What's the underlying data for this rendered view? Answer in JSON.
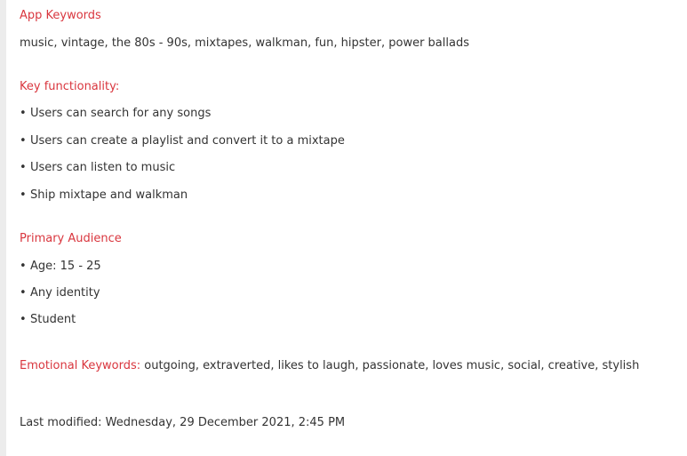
{
  "sections": {
    "app_keywords": {
      "heading": "App Keywords",
      "text": "music, vintage, the 80s - 90s, mixtapes, walkman, fun, hipster, power ballads"
    },
    "key_functionality": {
      "heading": "Key functionality:",
      "items": [
        "Users can search for any songs",
        "Users can create a playlist and convert it to a mixtape",
        "Users can listen to music",
        "Ship mixtape and walkman"
      ]
    },
    "primary_audience": {
      "heading": "Primary Audience",
      "items": [
        "Age: 15 - 25",
        "Any identity",
        "Student"
      ]
    },
    "emotional_keywords": {
      "heading": "Emotional Keywords:",
      "text": " outgoing, extraverted, likes to laugh, passionate, loves music, social, creative, stylish"
    }
  },
  "footer": {
    "label": "Last modified: ",
    "value": "Wednesday, 29 December 2021, 2:45 PM"
  },
  "bullet_symbol": "•"
}
